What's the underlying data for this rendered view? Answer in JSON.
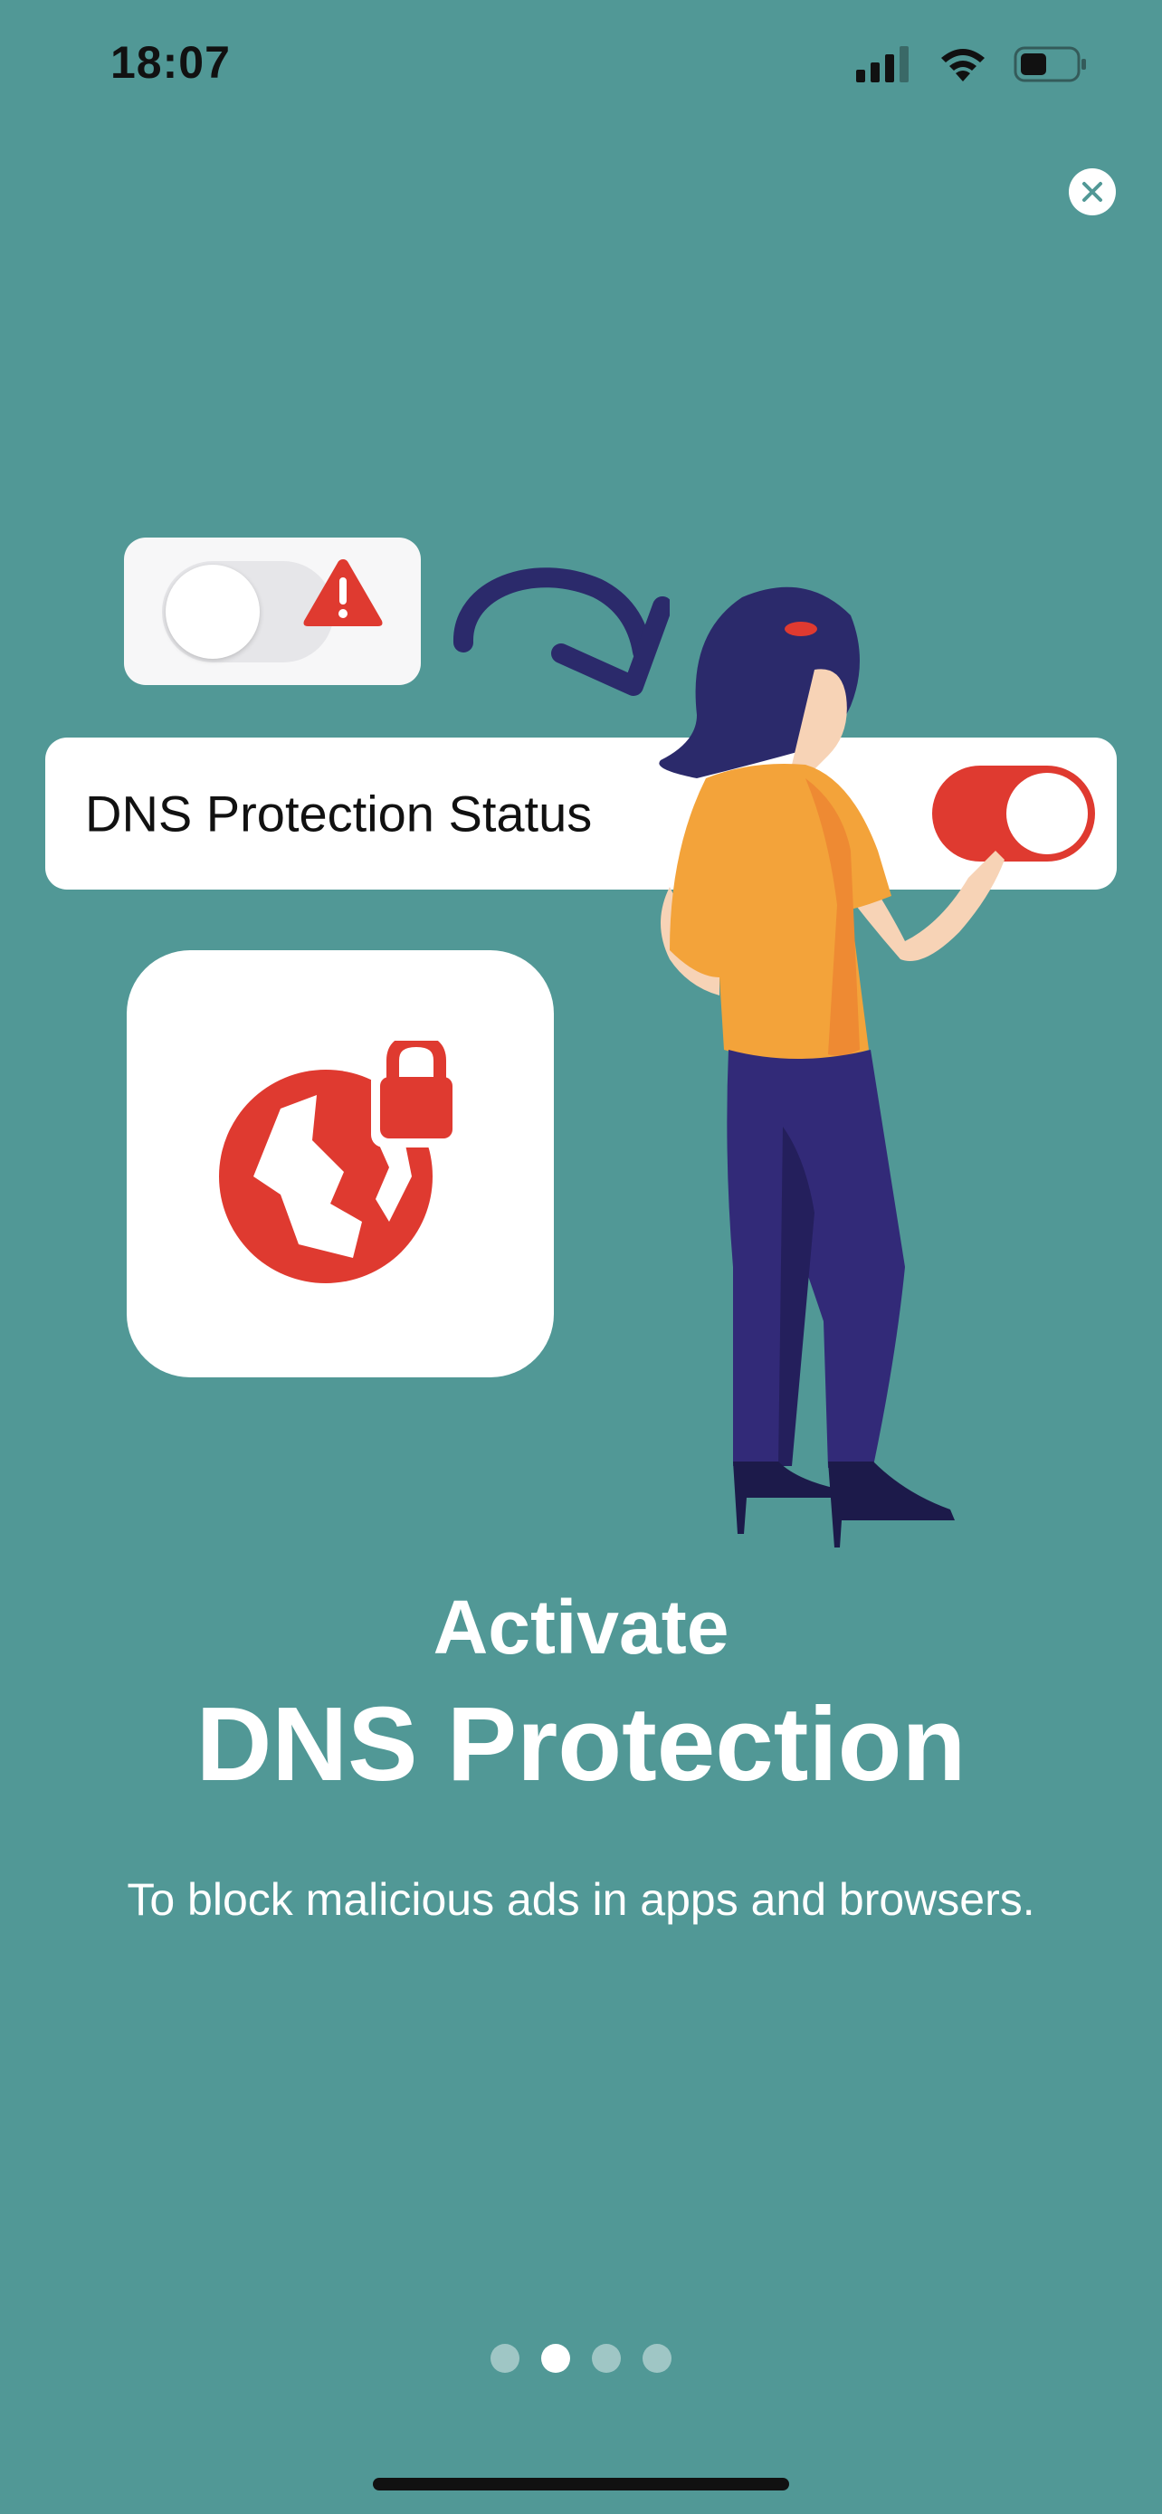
{
  "status_bar": {
    "time": "18:07",
    "icons": [
      "cellular-signal-icon",
      "wifi-icon",
      "battery-icon"
    ]
  },
  "close_button": {
    "icon": "close-icon"
  },
  "illustration": {
    "status_card_label": "DNS Protection Status",
    "icons": [
      "toggle-off-icon",
      "warning-icon",
      "curved-arrow-icon",
      "toggle-on-icon",
      "globe-lock-icon",
      "person-illustration"
    ]
  },
  "headline": {
    "line1": "Activate",
    "line2": "DNS Protection"
  },
  "subtitle": "To block malicious ads in apps and browsers.",
  "pagination": {
    "total": 4,
    "active_index": 1
  },
  "colors": {
    "background": "#519896",
    "accent_red": "#df3a30",
    "card": "#ffffff",
    "text_light": "#ffffff"
  }
}
